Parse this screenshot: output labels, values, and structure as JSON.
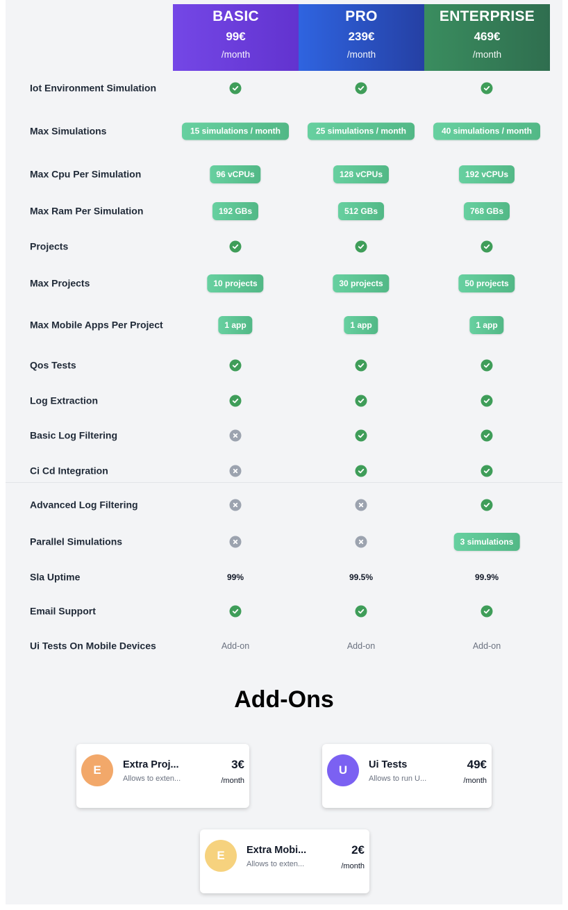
{
  "plans": [
    {
      "name": "BASIC",
      "price": "99€",
      "period": "/month"
    },
    {
      "name": "PRO",
      "price": "239€",
      "period": "/month"
    },
    {
      "name": "ENTERPRISE",
      "price": "469€",
      "period": "/month"
    }
  ],
  "features": [
    {
      "label": "Iot Environment Simulation",
      "values": [
        {
          "type": "check"
        },
        {
          "type": "check"
        },
        {
          "type": "check"
        }
      ]
    },
    {
      "label": "Max Simulations",
      "values": [
        {
          "type": "pill",
          "text": "15 simulations / month"
        },
        {
          "type": "pill",
          "text": "25 simulations / month"
        },
        {
          "type": "pill",
          "text": "40 simulations / month"
        }
      ]
    },
    {
      "label": "Max Cpu Per Simulation",
      "values": [
        {
          "type": "pill",
          "text": "96 vCPUs"
        },
        {
          "type": "pill",
          "text": "128 vCPUs"
        },
        {
          "type": "pill",
          "text": "192 vCPUs"
        }
      ]
    },
    {
      "label": "Max Ram Per Simulation",
      "values": [
        {
          "type": "pill",
          "text": "192 GBs"
        },
        {
          "type": "pill",
          "text": "512 GBs"
        },
        {
          "type": "pill",
          "text": "768 GBs"
        }
      ]
    },
    {
      "label": "Projects",
      "values": [
        {
          "type": "check"
        },
        {
          "type": "check"
        },
        {
          "type": "check"
        }
      ]
    },
    {
      "label": "Max Projects",
      "values": [
        {
          "type": "pill",
          "text": "10 projects"
        },
        {
          "type": "pill",
          "text": "30 projects"
        },
        {
          "type": "pill",
          "text": "50 projects"
        }
      ]
    },
    {
      "label": "Max Mobile Apps Per Project",
      "values": [
        {
          "type": "pill",
          "text": "1 app"
        },
        {
          "type": "pill",
          "text": "1 app"
        },
        {
          "type": "pill",
          "text": "1 app"
        }
      ]
    },
    {
      "label": "Qos Tests",
      "values": [
        {
          "type": "check"
        },
        {
          "type": "check"
        },
        {
          "type": "check"
        }
      ]
    },
    {
      "label": "Log Extraction",
      "values": [
        {
          "type": "check"
        },
        {
          "type": "check"
        },
        {
          "type": "check"
        }
      ]
    },
    {
      "label": "Basic Log Filtering",
      "values": [
        {
          "type": "cross"
        },
        {
          "type": "check"
        },
        {
          "type": "check"
        }
      ]
    },
    {
      "label": "Ci Cd Integration",
      "values": [
        {
          "type": "cross"
        },
        {
          "type": "check"
        },
        {
          "type": "check"
        }
      ]
    },
    {
      "label": "Advanced Log Filtering",
      "values": [
        {
          "type": "cross"
        },
        {
          "type": "cross"
        },
        {
          "type": "check"
        }
      ]
    },
    {
      "label": "Parallel Simulations",
      "values": [
        {
          "type": "cross"
        },
        {
          "type": "cross"
        },
        {
          "type": "pill",
          "text": "3 simulations"
        }
      ]
    },
    {
      "label": "Sla Uptime",
      "values": [
        {
          "type": "plain",
          "text": "99%"
        },
        {
          "type": "plain",
          "text": "99.5%"
        },
        {
          "type": "plain",
          "text": "99.9%"
        }
      ]
    },
    {
      "label": "Email Support",
      "values": [
        {
          "type": "check"
        },
        {
          "type": "check"
        },
        {
          "type": "check"
        }
      ]
    },
    {
      "label": "Ui Tests On Mobile Devices",
      "values": [
        {
          "type": "addon",
          "text": "Add-on"
        },
        {
          "type": "addon",
          "text": "Add-on"
        },
        {
          "type": "addon",
          "text": "Add-on"
        }
      ]
    }
  ],
  "addons_title": "Add-Ons",
  "addons": [
    {
      "initial": "E",
      "name": "Extra Proj...",
      "desc": "Allows to exten...",
      "price": "3€",
      "period": "/month",
      "color": "#f2a86a"
    },
    {
      "initial": "U",
      "name": "Ui Tests",
      "desc": "Allows to run U...",
      "price": "49€",
      "period": "/month",
      "color": "#7b61f2"
    },
    {
      "initial": "E",
      "name": "Extra Mobi...",
      "desc": "Allows to exten...",
      "price": "2€",
      "period": "/month",
      "color": "#f6d27e"
    }
  ],
  "colors": {
    "basic": "#6a3ddb",
    "pro": "#2a52c6",
    "enterprise": "#357c57",
    "check": "#3f9d59",
    "cross": "#9ca3af",
    "pill": "#5cc493"
  }
}
